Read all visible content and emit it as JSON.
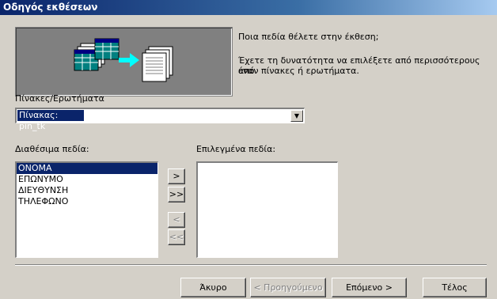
{
  "window": {
    "title": "Οδηγός εκθέσεων"
  },
  "intro": {
    "question": "Ποια πεδία θέλετε στην έκθεση;",
    "hint_line1": "Έχετε τη δυνατότητα να επιλέξετε από περισσότερους από",
    "hint_line2": "έναν πίνακες ή ερωτήματα."
  },
  "source": {
    "label": "Πίνακες/Ερωτήματα",
    "selected": "Πίνακας: pin_tk"
  },
  "available": {
    "label": "Διαθέσιμα πεδία:",
    "items": [
      "ΟΝΟΜΑ",
      "ΕΠΩΝΥΜΟ",
      "ΔΙΕΥΘΥΝΣΗ",
      "ΤΗΛΕΦΩΝΟ"
    ],
    "selected_index": 0
  },
  "selected_fields": {
    "label": "Επιλεγμένα πεδία:",
    "items": []
  },
  "move_buttons": {
    "add_one": ">",
    "add_all": ">>",
    "remove_one": "<",
    "remove_all": "<<"
  },
  "footer": {
    "cancel": "Άκυρο",
    "back": "< Προηγούμενο",
    "next": "Επόμενο >",
    "finish": "Τέλος"
  }
}
